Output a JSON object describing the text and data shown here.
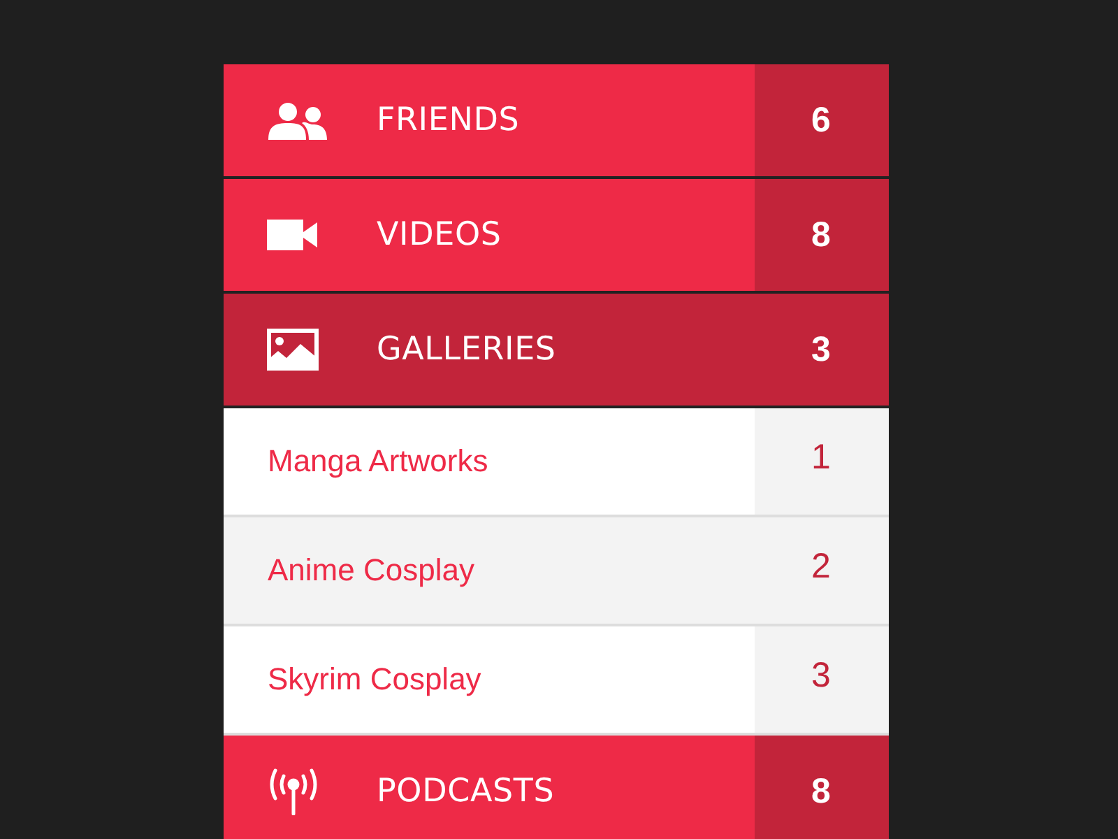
{
  "menu": [
    {
      "kind": "people",
      "label": "FRIENDS",
      "count": "6",
      "selected": false
    },
    {
      "kind": "camera",
      "label": "VIDEOS",
      "count": "8",
      "selected": false
    },
    {
      "kind": "image",
      "label": "GALLERIES",
      "count": "3",
      "selected": true,
      "children": [
        {
          "label": "Manga Artworks",
          "count": "1",
          "selected": false
        },
        {
          "label": "Anime Cosplay",
          "count": "2",
          "selected": true
        },
        {
          "label": "Skyrim Cosplay",
          "count": "3",
          "selected": false
        }
      ]
    },
    {
      "kind": "antenna",
      "label": "PODCASTS",
      "count": "8",
      "selected": false
    }
  ]
}
